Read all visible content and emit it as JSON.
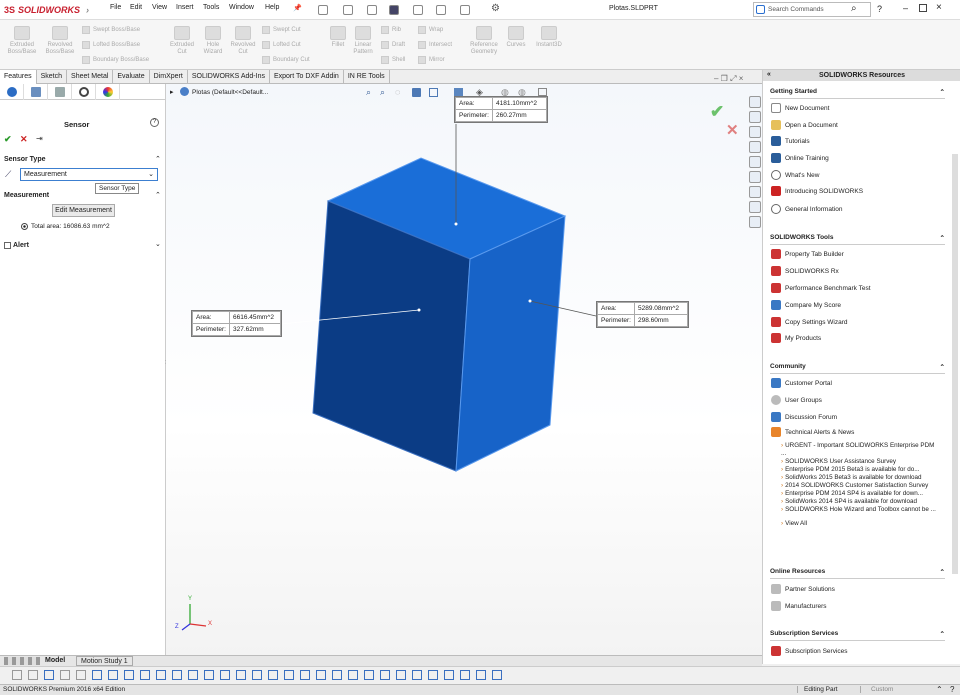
{
  "app": {
    "logo": "SOLIDWORKS",
    "file_title": "Plotas.SLDPRT"
  },
  "menu": [
    "File",
    "Edit",
    "View",
    "Insert",
    "Tools",
    "Window",
    "Help"
  ],
  "search": {
    "placeholder": "Search Commands"
  },
  "commands": {
    "extruded_boss": "Extruded Boss/Base",
    "revolved_boss": "Revolved Boss/Base",
    "swept_boss": "Swept Boss/Base",
    "lofted_boss": "Lofted Boss/Base",
    "boundary_boss": "Boundary Boss/Base",
    "extruded_cut": "Extruded Cut",
    "hole_wizard": "Hole Wizard",
    "revolved_cut": "Revolved Cut",
    "swept_cut": "Swept Cut",
    "lofted_cut": "Lofted Cut",
    "boundary_cut": "Boundary Cut",
    "fillet": "Fillet",
    "linear_pattern": "Linear Pattern",
    "rib": "Rib",
    "draft": "Draft",
    "shell": "Shell",
    "wrap": "Wrap",
    "intersect": "Intersect",
    "mirror": "Mirror",
    "reference_geometry": "Reference Geometry",
    "curves": "Curves",
    "instant3d": "Instant3D"
  },
  "tabs": [
    "Features",
    "Sketch",
    "Sheet Metal",
    "Evaluate",
    "DimXpert",
    "SOLIDWORKS Add-Ins",
    "Export To DXF Addin",
    "IN RE Tools"
  ],
  "property_manager": {
    "title": "Sensor",
    "sensor_type_header": "Sensor Type",
    "sensor_type_value": "Measurement",
    "tooltip": "Sensor Type",
    "measurement_header": "Measurement",
    "edit_button": "Edit Measurement",
    "total_area": "Total area: 16086.63 mm^2",
    "alert_label": "Alert"
  },
  "tree": {
    "root": "Plotas  (Default<<Default..."
  },
  "callouts": {
    "top": {
      "area_label": "Area:",
      "area": "4181.10mm^2",
      "perim_label": "Perimeter:",
      "perim": "260.27mm"
    },
    "left": {
      "area_label": "Area:",
      "area": "6616.45mm^2",
      "perim_label": "Perimeter:",
      "perim": "327.62mm"
    },
    "right": {
      "area_label": "Area:",
      "area": "5289.08mm^2",
      "perim_label": "Perimeter:",
      "perim": "298.60mm"
    }
  },
  "triad": {
    "x": "X",
    "y": "Y",
    "z": "Z"
  },
  "task_pane": {
    "title": "SOLIDWORKS Resources",
    "getting_started": {
      "header": "Getting Started",
      "items": [
        "New Document",
        "Open a Document",
        "Tutorials",
        "Online Training",
        "What's New",
        "Introducing SOLIDWORKS",
        "General Information"
      ]
    },
    "tools": {
      "header": "SOLIDWORKS Tools",
      "items": [
        "Property Tab Builder",
        "SOLIDWORKS Rx",
        "Performance Benchmark Test",
        "Compare My Score",
        "Copy Settings Wizard",
        "My Products"
      ]
    },
    "community": {
      "header": "Community",
      "items": [
        "Customer Portal",
        "User Groups",
        "Discussion Forum",
        "Technical Alerts & News"
      ]
    },
    "news": [
      "URGENT - Important SOLIDWORKS Enterprise PDM ...",
      "SOLIDWORKS User Assistance Survey",
      "Enterprise PDM 2015 Beta3 is available for do...",
      "SolidWorks 2015 Beta3 is available for download",
      "2014 SOLIDWORKS Customer Satisfaction Survey",
      "Enterprise PDM 2014 SP4 is available for down...",
      "SolidWorks 2014 SP4 is available for download",
      "SOLIDWORKS Hole Wizard and Toolbox cannot be ..."
    ],
    "view_all": "View All",
    "online_resources": {
      "header": "Online Resources",
      "items": [
        "Partner Solutions",
        "Manufacturers"
      ]
    },
    "subscription": {
      "header": "Subscription Services",
      "items": [
        "Subscription Services"
      ]
    }
  },
  "bottom_tabs": [
    "Model",
    "Motion Study 1"
  ],
  "status": {
    "edition": "SOLIDWORKS Premium 2016 x64 Edition",
    "mode": "Editing Part",
    "units": "Custom"
  },
  "colors": {
    "box_top": "#1a6ed8",
    "box_front": "#0b3c85",
    "box_side": "#1763c8",
    "accent": "#c8202f"
  }
}
